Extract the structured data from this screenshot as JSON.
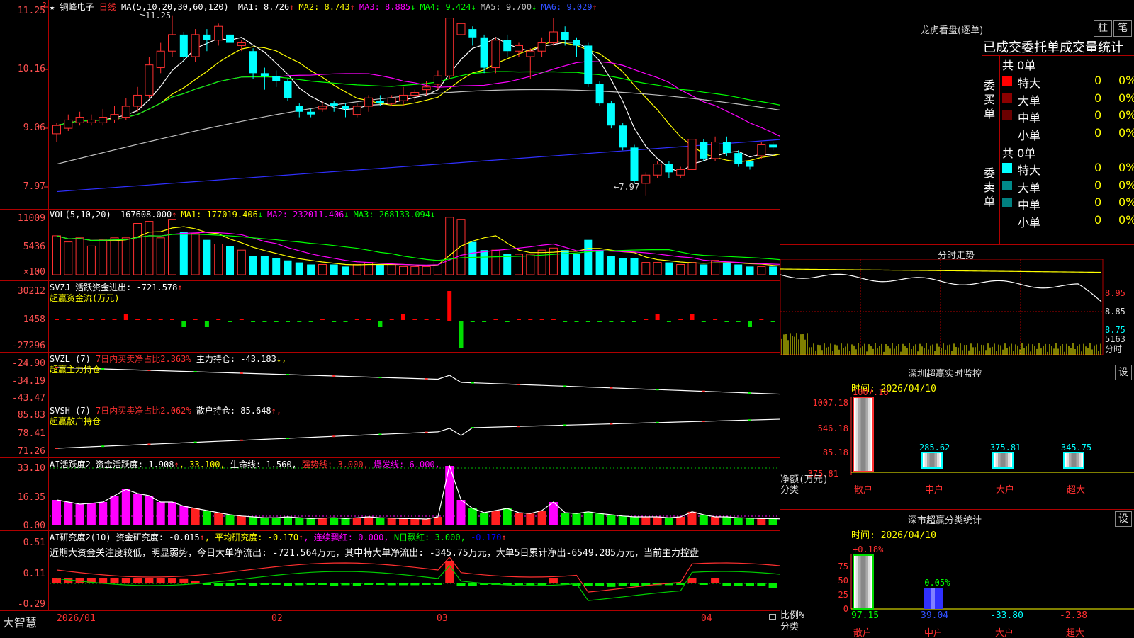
{
  "stock": {
    "name": "铜峰电子",
    "period": "日线",
    "star": "★"
  },
  "main_panel": {
    "ma_header": "MA(5,10,20,30,60,120)",
    "ma_values": [
      {
        "label": "MA1:",
        "value": "8.726",
        "arrow": "↑",
        "color": "#ffffff"
      },
      {
        "label": "MA2:",
        "value": "8.743",
        "arrow": "↑",
        "color": "#ffff00"
      },
      {
        "label": "MA3:",
        "value": "8.885",
        "arrow": "↓",
        "color": "#ff00ff"
      },
      {
        "label": "MA4:",
        "value": "9.424",
        "arrow": "↓",
        "color": "#00ff00"
      },
      {
        "label": "MA5:",
        "value": "9.700",
        "arrow": "↓",
        "color": "#c0c0c0"
      },
      {
        "label": "MA6:",
        "value": "9.029",
        "arrow": "↑",
        "color": "#0000ff"
      }
    ],
    "yticks": [
      "11.25",
      "10.16",
      "9.06",
      "7.97"
    ],
    "high_annot": "11.25",
    "low_annot": "7.97",
    "corner_mark": "?"
  },
  "vol_panel": {
    "header": "VOL(5,10,20)",
    "values": [
      {
        "text": "167608.000",
        "arrow": "↑",
        "color": "#ffffff"
      },
      {
        "text": "MA1: 177019.406",
        "arrow": "↓",
        "color": "#ffff00"
      },
      {
        "text": "MA2: 232011.406",
        "arrow": "↓",
        "color": "#ff00ff"
      },
      {
        "text": "MA3: 268133.094",
        "arrow": "↓",
        "color": "#00ff00"
      }
    ],
    "yticks": [
      "11009",
      "5436",
      "×100"
    ]
  },
  "svzj_panel": {
    "header": "SVZJ  活跃资金进出: -721.578",
    "arrow": "↑",
    "sub": "超赢资金流(万元)",
    "yticks": [
      "30212",
      "1458",
      "-27296"
    ]
  },
  "svzl_panel": {
    "prefix": "SVZL (7)",
    "mid": "7日内买卖净占比2.363%",
    "suffix": "主力持仓: -43.183",
    "arrow": "↓,",
    "sub": "超赢主力持仓",
    "yticks": [
      "-24.90",
      "-34.19",
      "-43.47"
    ]
  },
  "svsh_panel": {
    "prefix": "SVSH (7)",
    "mid": "7日内买卖净占比2.062%",
    "suffix": "散户持仓: 85.648",
    "arrow": "↑,",
    "sub": "超赢散户持仓",
    "yticks": [
      "85.83",
      "78.41",
      "71.26"
    ]
  },
  "ai_active": {
    "prefix": "AI活跃度2 资金活跃度: 1.908",
    "arrow": "↑",
    "v2": ", 33.100,",
    "life": "生命线: 1.560,",
    "strong": "强势线: 3.000,",
    "burst": "爆发线: 6.000,",
    "yticks": [
      "33.10",
      "16.35",
      "0.00"
    ]
  },
  "ai_research": {
    "prefix": "AI研究度2(10) 资金研究度: -0.015",
    "arrow1": "↑",
    "avg": ", 平均研究度: -0.170",
    "arrow2": "↑",
    "red_lbl": ", 连续飘红: 0.000,",
    "n_lbl": "N日飘红: 3.000,",
    "last": "-0.170",
    "arrow3": "↑",
    "comment": "近期大资金关注度较低，明显弱势，今日大单净流出: -721.564万元，其中特大单净流出: -345.75万元，大单5日累计净出-6549.285万元，当前主力控盘",
    "yticks": [
      "0.51",
      "0.11",
      "-0.29"
    ]
  },
  "x_axis": {
    "labels": [
      "2026/01",
      "02",
      "03",
      "04"
    ],
    "brand": "大智慧"
  },
  "lhb": {
    "title": "龙虎看盘(逐单)",
    "btn1": "柱",
    "btn2": "笔",
    "tabs": [
      "已成交",
      "委托单",
      "成交量",
      "统计"
    ],
    "buy_label": "委买单",
    "sell_label": "委卖单",
    "buy_total": "共 0单",
    "sell_total": "共 0单",
    "rows": [
      "特大",
      "大单",
      "中单",
      "小单"
    ],
    "zero": "0",
    "pct": "0%"
  },
  "intraday": {
    "title": "分时走势",
    "yticks": [
      "8.95",
      "8.85",
      "8.75"
    ],
    "vol_tick": "5163",
    "unit": "分时"
  },
  "sz_monitor": {
    "title": "深圳超赢实时监控",
    "btn": "设",
    "time": "时间: 2026/04/10",
    "top_value": "1007.18",
    "yticks": [
      "1007.18",
      "546.18",
      "85.18",
      "-375.81"
    ],
    "left_labels": [
      "净额(万元)",
      "分类"
    ],
    "bars": [
      {
        "cat": "散户",
        "val": "1007.18"
      },
      {
        "cat": "中户",
        "val": "-285.62"
      },
      {
        "cat": "大户",
        "val": "-375.81"
      },
      {
        "cat": "超大",
        "val": "-345.75"
      }
    ]
  },
  "sz_class": {
    "title": "深市超赢分类统计",
    "btn": "设",
    "time": "时间: 2026/04/10",
    "top_pct": "+0.18%",
    "mid_pct": "-0.05%",
    "yticks": [
      "75",
      "50",
      "25",
      "0"
    ],
    "left_labels": [
      "比例%",
      "分类"
    ],
    "bars": [
      {
        "cat": "散户",
        "val": "97.15"
      },
      {
        "cat": "中户",
        "val": "39.04"
      },
      {
        "cat": "大户",
        "val": "-33.80"
      },
      {
        "cat": "超大",
        "val": "-2.38"
      }
    ]
  },
  "chart_data": {
    "type": "candlestick",
    "dates_axis": [
      "2026/01",
      "02",
      "03",
      "04"
    ],
    "ohlc_approx": [
      [
        9.1,
        9.25,
        9.3,
        8.95
      ],
      [
        9.2,
        9.35,
        9.45,
        9.15
      ],
      [
        9.3,
        9.4,
        9.5,
        9.25
      ],
      [
        9.3,
        9.35,
        9.45,
        9.25
      ],
      [
        9.3,
        9.4,
        9.55,
        9.25
      ],
      [
        9.35,
        9.45,
        9.6,
        9.3
      ],
      [
        9.4,
        9.6,
        9.75,
        9.35
      ],
      [
        9.6,
        9.8,
        9.95,
        9.5
      ],
      [
        9.8,
        10.35,
        10.5,
        9.75
      ],
      [
        10.3,
        10.6,
        10.75,
        10.2
      ],
      [
        10.6,
        10.9,
        11.25,
        10.5
      ],
      [
        10.9,
        10.5,
        10.95,
        10.4
      ],
      [
        10.5,
        10.9,
        11.0,
        10.4
      ],
      [
        10.9,
        10.8,
        11.0,
        10.6
      ],
      [
        10.8,
        11.05,
        11.1,
        10.7
      ],
      [
        10.9,
        10.75,
        10.95,
        10.6
      ],
      [
        10.7,
        10.75,
        10.8,
        10.6
      ],
      [
        10.6,
        10.2,
        10.65,
        10.1
      ],
      [
        10.2,
        10.15,
        10.3,
        9.9
      ],
      [
        10.15,
        10.05,
        10.25,
        9.95
      ],
      [
        10.05,
        9.75,
        10.1,
        9.7
      ],
      [
        9.6,
        9.5,
        9.65,
        9.4
      ],
      [
        9.5,
        9.45,
        9.55,
        9.4
      ],
      [
        9.55,
        9.6,
        9.7,
        9.5
      ],
      [
        9.65,
        9.6,
        9.7,
        9.5
      ],
      [
        9.6,
        9.55,
        9.65,
        9.4
      ],
      [
        9.45,
        9.6,
        9.65,
        9.4
      ],
      [
        9.6,
        9.75,
        9.8,
        9.5
      ],
      [
        9.7,
        9.65,
        9.8,
        9.6
      ],
      [
        9.65,
        9.75,
        9.8,
        9.6
      ],
      [
        9.7,
        9.8,
        9.95,
        9.6
      ],
      [
        9.8,
        9.85,
        9.9,
        9.7
      ],
      [
        9.9,
        9.95,
        10.05,
        9.8
      ],
      [
        10.0,
        10.15,
        10.25,
        9.9
      ],
      [
        10.15,
        11.2,
        11.2,
        10.1
      ],
      [
        10.9,
        11.1,
        11.25,
        10.8
      ],
      [
        11.0,
        10.85,
        11.05,
        10.7
      ],
      [
        10.85,
        10.3,
        10.9,
        10.2
      ],
      [
        10.3,
        10.8,
        10.85,
        10.2
      ],
      [
        10.8,
        10.6,
        10.9,
        10.5
      ],
      [
        10.6,
        10.7,
        10.75,
        10.5
      ],
      [
        10.5,
        10.6,
        10.65,
        10.1
      ],
      [
        10.6,
        10.75,
        10.85,
        10.5
      ],
      [
        10.75,
        10.95,
        11.2,
        10.7
      ],
      [
        10.95,
        10.8,
        11.05,
        10.7
      ],
      [
        10.8,
        10.7,
        10.85,
        10.5
      ],
      [
        10.7,
        10.0,
        10.75,
        9.95
      ],
      [
        10.0,
        9.65,
        10.05,
        9.6
      ],
      [
        9.65,
        9.25,
        9.7,
        9.2
      ],
      [
        9.25,
        8.85,
        9.3,
        8.8
      ],
      [
        8.85,
        8.25,
        8.9,
        8.2
      ],
      [
        8.2,
        8.35,
        8.4,
        7.97
      ],
      [
        8.35,
        8.55,
        8.6,
        8.3
      ],
      [
        8.55,
        8.4,
        8.6,
        8.3
      ],
      [
        8.35,
        8.45,
        8.5,
        8.3
      ],
      [
        8.45,
        9.0,
        9.4,
        8.4
      ],
      [
        8.95,
        8.65,
        9.0,
        8.6
      ],
      [
        8.65,
        8.95,
        9.05,
        8.6
      ],
      [
        8.95,
        8.75,
        9.05,
        8.7
      ],
      [
        8.75,
        8.55,
        8.8,
        8.5
      ],
      [
        8.6,
        8.5,
        8.6,
        8.45
      ],
      [
        8.7,
        8.9,
        8.95,
        8.65
      ],
      [
        8.9,
        8.85,
        8.95,
        8.8
      ],
      [
        8.85,
        8.92,
        9.0,
        8.8
      ]
    ],
    "ma_lines": [
      "MA1",
      "MA2",
      "MA3",
      "MA4",
      "MA5",
      "MA6"
    ]
  }
}
